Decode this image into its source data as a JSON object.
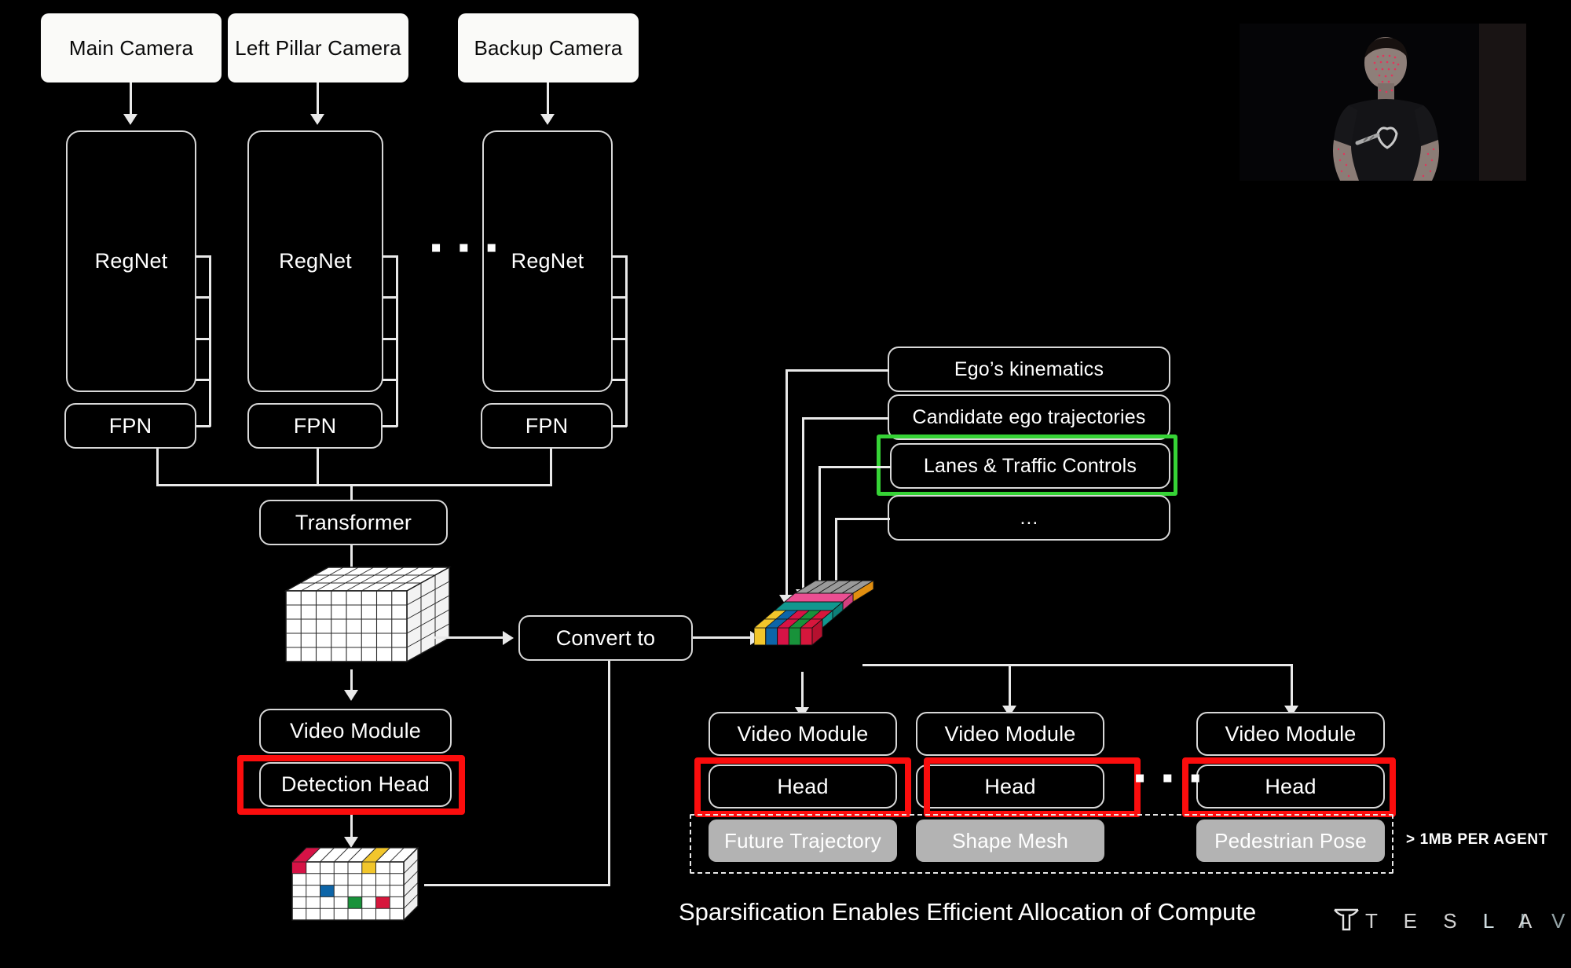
{
  "slide": {
    "caption": "Sparsification Enables Efficient Allocation of Compute",
    "agent_note": "> 1MB PER AGENT",
    "brand_tesla": "T E S L A",
    "brand_live": "L I V E",
    "ellipsis": "▪ ▪ ▪"
  },
  "colors": {
    "background": "#000000",
    "stroke": "#e9e9e9",
    "highlight_red": "#fb0d0d",
    "highlight_green": "#36d336",
    "gray_box": "#b3b3b3",
    "white_box": "#fafaf8",
    "cube_yellow": "#f2c62b",
    "cube_blue": "#0d65a8",
    "cube_crimson": "#d61346",
    "cube_green": "#18923a",
    "cube_red": "#d6173c",
    "cube_teal": "#11978f",
    "cube_pink": "#ea4f92",
    "cube_orange": "#f0a01e",
    "cube_gray": "#9a9a9a"
  },
  "cameras": [
    {
      "label": "Main Camera"
    },
    {
      "label": "Left Pillar Camera"
    },
    {
      "label": "Backup Camera"
    }
  ],
  "backbones": [
    {
      "label": "RegNet"
    },
    {
      "label": "RegNet"
    },
    {
      "label": "RegNet"
    }
  ],
  "fpns": [
    {
      "label": "FPN"
    },
    {
      "label": "FPN"
    },
    {
      "label": "FPN"
    }
  ],
  "left_pipeline": {
    "transformer": "Transformer",
    "video_module": "Video Module",
    "detection_head": "Detection Head",
    "convert_to": "Convert to"
  },
  "context_inputs": [
    {
      "label": "Ego’s kinematics",
      "highlighted": false
    },
    {
      "label": "Candidate ego trajectories",
      "highlighted": false
    },
    {
      "label": "Lanes & Traffic Controls",
      "highlighted": true
    },
    {
      "label": "…",
      "highlighted": false
    }
  ],
  "agent_columns": [
    {
      "video_module": "Video Module",
      "head": "Head",
      "output": "Future Trajectory"
    },
    {
      "video_module": "Video Module",
      "head": "Head",
      "output": "Shape Mesh"
    },
    {
      "video_module": "Video Module",
      "head": "Head",
      "output": "Pedestrian Pose"
    }
  ],
  "dense_tensor": {
    "name": "dense-feature-cube",
    "cols": 8,
    "rows": 5,
    "fill": "white"
  },
  "sparse_tensor_left": {
    "name": "sparse-detection-grid",
    "cols": 8,
    "rows": 5,
    "colored_cells": [
      {
        "row": 0,
        "col": 0,
        "color": "#d61346"
      },
      {
        "row": 0,
        "col": 5,
        "color": "#f2c62b"
      },
      {
        "row": 2,
        "col": 2,
        "color": "#0d65a8"
      },
      {
        "row": 3,
        "col": 4,
        "color": "#18923a"
      },
      {
        "row": 3,
        "col": 6,
        "color": "#d6173c"
      }
    ]
  },
  "sparse_tensor_right": {
    "name": "agent-token-slab",
    "cols": 5,
    "rows": 5,
    "row_colors": [
      [
        "#f2c62b",
        "#0d65a8",
        "#d61346",
        "#18923a",
        "#d6173c"
      ],
      [
        "#f2c62b",
        "#0d65a8",
        "#d61346",
        "#18923a",
        "#d6173c"
      ],
      [
        "#11978f",
        "#11978f",
        "#11978f",
        "#11978f",
        "#11978f"
      ],
      [
        "#ea4f92",
        "#ea4f92",
        "#ea4f92",
        "#ea4f92",
        "#ea4f92"
      ],
      [
        "#f0a01e",
        "#f0a01e",
        "#f0a01e",
        "#f0a01e",
        "#f0a01e"
      ]
    ],
    "top_color": "#9a9a9a"
  },
  "presenter": {
    "name": "presenter-video-feed"
  }
}
